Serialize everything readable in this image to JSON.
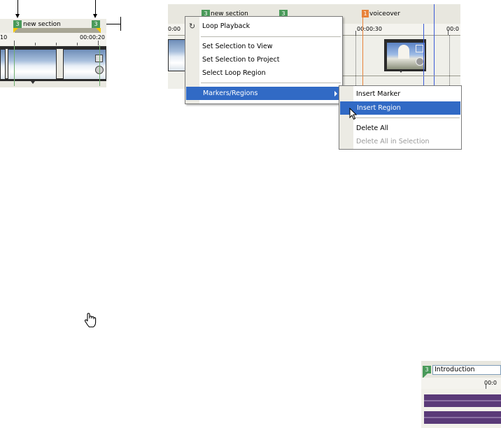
{
  "panel_a": {
    "region_name": "new section",
    "region_start_number": "3",
    "region_end_number": "3",
    "ruler_left_label": "10",
    "ruler_right_label": "00:00:20"
  },
  "panel_b": {
    "ruler_left_label": "0:00",
    "ruler_mid_label": "00:00:30",
    "ruler_right_label": "00:0",
    "region_marker_number": "3",
    "region_name": "new section",
    "region_marker_number_2": "3",
    "voiceover_marker_number": "1",
    "voiceover_label": "voiceover",
    "context_menu": {
      "loop_playback": "Loop Playback",
      "set_selection_view": "Set Selection to View",
      "set_selection_project": "Set Selection to Project",
      "select_loop_region": "Select Loop Region",
      "markers_regions": "Markers/Regions"
    },
    "submenu": {
      "insert_marker": "Insert Marker",
      "insert_region": "Insert Region",
      "delete_all": "Delete All",
      "delete_all_in_selection": "Delete All in Selection"
    }
  },
  "panel_c": {
    "region_number": "3",
    "region_name_value": "Introduction"
  },
  "colors": {
    "menu_highlight": "#316ac5",
    "region_tag": "#4a9a5a",
    "marker_orange": "#e8823a",
    "waveform": "#5a3a78",
    "cursor_line": "#3a5ad8"
  },
  "icons": [
    "loop-icon",
    "hand-cursor-icon",
    "arrow-cursor-icon",
    "submenu-arrow-icon"
  ]
}
